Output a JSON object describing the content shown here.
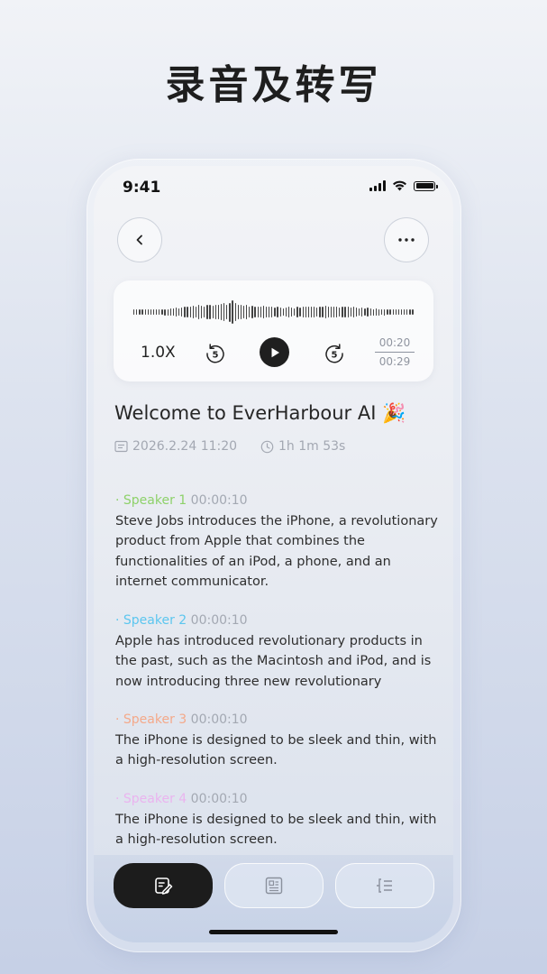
{
  "headline": "录音及转写",
  "status_bar": {
    "time": "9:41"
  },
  "player": {
    "speed": "1.0X",
    "current_time": "00:20",
    "total_time": "00:29",
    "rewind_seconds": "5",
    "forward_seconds": "5",
    "waveform": [
      0.2,
      0.2,
      0.2,
      0.2,
      0.2,
      0.2,
      0.2,
      0.2,
      0.2,
      0.2,
      0.2,
      0.25,
      0.25,
      0.3,
      0.3,
      0.35,
      0.3,
      0.35,
      0.4,
      0.45,
      0.4,
      0.5,
      0.45,
      0.55,
      0.5,
      0.45,
      0.55,
      0.6,
      0.5,
      0.55,
      0.6,
      0.65,
      0.7,
      0.6,
      0.75,
      0.9,
      0.7,
      0.6,
      0.55,
      0.5,
      0.55,
      0.45,
      0.5,
      0.45,
      0.4,
      0.45,
      0.5,
      0.45,
      0.4,
      0.45,
      0.35,
      0.4,
      0.35,
      0.3,
      0.35,
      0.4,
      0.35,
      0.3,
      0.4,
      0.35,
      0.4,
      0.45,
      0.4,
      0.45,
      0.4,
      0.35,
      0.4,
      0.45,
      0.5,
      0.45,
      0.4,
      0.45,
      0.4,
      0.35,
      0.4,
      0.45,
      0.4,
      0.35,
      0.4,
      0.35,
      0.3,
      0.35,
      0.3,
      0.35,
      0.3,
      0.25,
      0.3,
      0.25,
      0.2,
      0.25,
      0.2,
      0.2,
      0.2,
      0.2,
      0.2,
      0.2,
      0.2,
      0.2,
      0.2,
      0.2
    ]
  },
  "record": {
    "title": "Welcome to EverHarbour AI",
    "title_emoji": "🎉",
    "date": "2026.2.24 11:20",
    "duration": "1h 1m 53s"
  },
  "transcript": [
    {
      "dot": "·",
      "speaker": "Speaker 1",
      "time": "00:00:10",
      "color": "#8ed16a",
      "text": "Steve Jobs introduces the iPhone, a revolutionary product from Apple that combines the functionalities of an iPod, a phone, and an internet communicator."
    },
    {
      "dot": "·",
      "speaker": "Speaker 2",
      "time": "00:00:10",
      "color": "#5cc6ef",
      "text": "Apple has introduced revolutionary products in the past, such as the Macintosh and iPod, and is now introducing three new revolutionary"
    },
    {
      "dot": "·",
      "speaker": "Speaker 3",
      "time": "00:00:10",
      "color": "#f4a98a",
      "text": "The iPhone is designed to be sleek and thin, with a high-resolution screen."
    },
    {
      "dot": "·",
      "speaker": "Speaker 4",
      "time": "00:00:10",
      "color": "#eab4ef",
      "text": "The iPhone is designed to be sleek and thin, with a high-resolution screen."
    }
  ],
  "icons": {
    "back": "chevron-left-icon",
    "more": "more-horizontal-icon",
    "rewind": "rewind-5-icon",
    "play": "play-icon",
    "forward": "forward-5-icon",
    "calendar": "calendar-icon",
    "clock": "clock-icon",
    "edit": "edit-note-icon",
    "document": "document-icon",
    "outline": "outline-list-icon"
  },
  "colors": {
    "accent_dark": "#1c1c1c",
    "muted_text": "#a3a8b2"
  }
}
